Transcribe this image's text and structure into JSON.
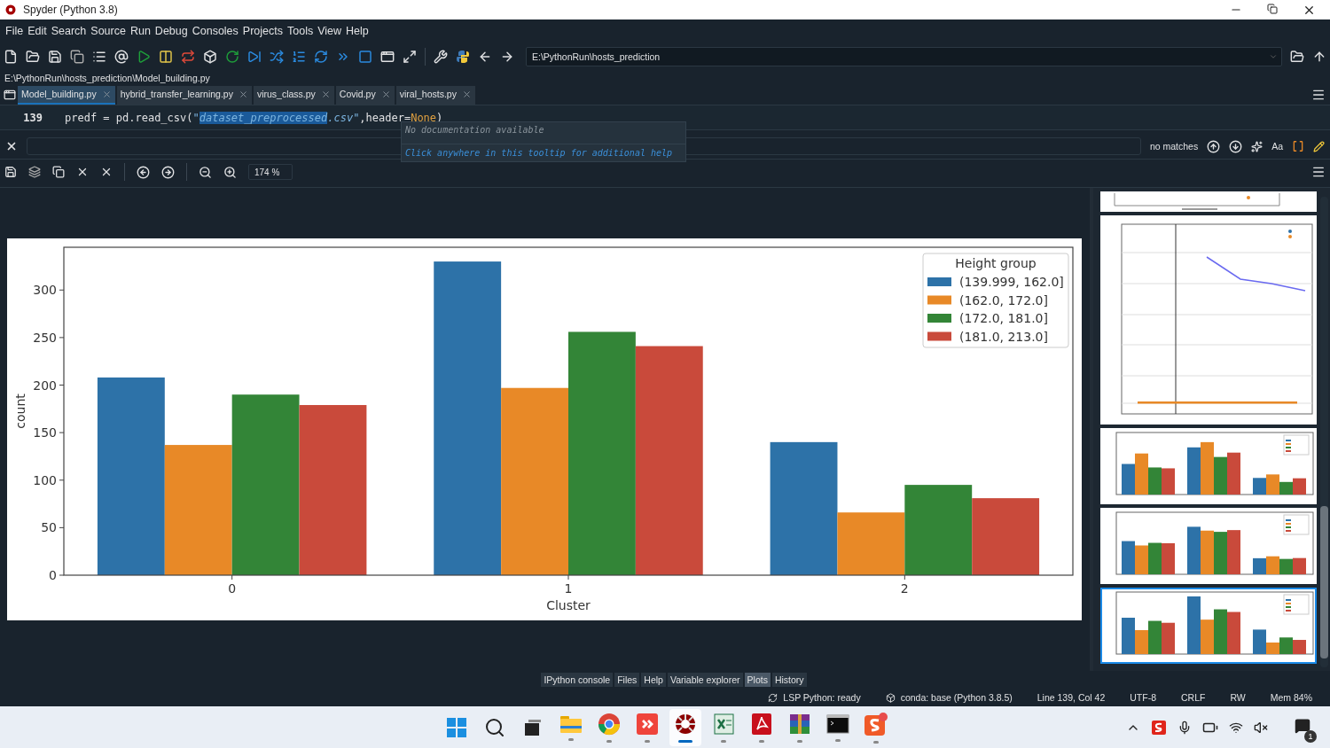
{
  "window": {
    "title": "Spyder (Python 3.8)"
  },
  "menu": [
    "File",
    "Edit",
    "Search",
    "Source",
    "Run",
    "Debug",
    "Consoles",
    "Projects",
    "Tools",
    "View",
    "Help"
  ],
  "toolbar": {
    "path": "E:\\PythonRun\\hosts_prediction"
  },
  "file_path": "E:\\PythonRun\\hosts_prediction\\Model_building.py",
  "editor_tabs": [
    {
      "label": "Model_building.py",
      "selected": true
    },
    {
      "label": "hybrid_transfer_learning.py",
      "selected": false
    },
    {
      "label": "virus_class.py",
      "selected": false
    },
    {
      "label": "Covid.py",
      "selected": false
    },
    {
      "label": "viral_hosts.py",
      "selected": false
    }
  ],
  "editor": {
    "line_number": "139",
    "code": [
      {
        "text": "predf = pd.read_csv(",
        "kind": "plain"
      },
      {
        "text": "\"",
        "kind": "string"
      },
      {
        "text": "dataset_preprocessed",
        "kind": "selected"
      },
      {
        "text": ".csv\"",
        "kind": "string"
      },
      {
        "text": ",header=",
        "kind": "plain"
      },
      {
        "text": "None",
        "kind": "keyword"
      },
      {
        "text": ")",
        "kind": "plain"
      }
    ]
  },
  "tooltip": {
    "message": "No documentation available",
    "hint": "Click anywhere in this tooltip for additional help"
  },
  "find_bar": {
    "status": "no matches",
    "case_label": "Aa"
  },
  "plots": {
    "zoom": "174 %",
    "plot": {
      "legend_title": "Height group",
      "chart_data": {
        "type": "bar",
        "xlabel": "Cluster",
        "ylabel": "count",
        "categories": [
          "0",
          "1",
          "2"
        ],
        "series": [
          {
            "name": "(139.999, 162.0]",
            "color": "#2d72a8",
            "values": [
              208,
              330,
              140
            ]
          },
          {
            "name": "(162.0, 172.0]",
            "color": "#e88927",
            "values": [
              137,
              197,
              66
            ]
          },
          {
            "name": "(172.0, 181.0]",
            "color": "#338537",
            "values": [
              190,
              256,
              95
            ]
          },
          {
            "name": "(181.0, 213.0]",
            "color": "#c94a3b",
            "values": [
              179,
              241,
              81
            ]
          }
        ],
        "ylim": [
          0,
          345
        ],
        "yticks": [
          0,
          50,
          100,
          150,
          200,
          250,
          300
        ],
        "legend": "upper right"
      }
    },
    "thumbnails": [
      {
        "kind": "partial",
        "selected": false
      },
      {
        "kind": "line",
        "selected": false
      },
      {
        "kind": "bar",
        "selected": false
      },
      {
        "kind": "bar",
        "selected": false
      },
      {
        "kind": "bar",
        "selected": true
      }
    ]
  },
  "panes": [
    {
      "label": "IPython console",
      "selected": false
    },
    {
      "label": "Files",
      "selected": false
    },
    {
      "label": "Help",
      "selected": false
    },
    {
      "label": "Variable explorer",
      "selected": false
    },
    {
      "label": "Plots",
      "selected": true
    },
    {
      "label": "History",
      "selected": false
    }
  ],
  "status_bar": {
    "lsp": "LSP Python: ready",
    "conda": "conda: base (Python 3.8.5)",
    "position": "Line 139, Col 42",
    "encoding": "UTF-8",
    "eol": "CRLF",
    "mode": "RW",
    "memory": "Mem 84%"
  },
  "taskbar": {
    "apps": [
      {
        "kind": "start",
        "running": false,
        "active": false
      },
      {
        "kind": "search",
        "running": false,
        "active": false
      },
      {
        "kind": "taskview",
        "running": false,
        "active": false
      },
      {
        "kind": "folder",
        "running": true,
        "active": false
      },
      {
        "kind": "browser",
        "running": true,
        "active": false
      },
      {
        "kind": "remote",
        "running": true,
        "active": false
      },
      {
        "kind": "spyder",
        "running": true,
        "active": true
      },
      {
        "kind": "sheet",
        "running": true,
        "active": false
      },
      {
        "kind": "pdf",
        "running": true,
        "active": false
      },
      {
        "kind": "archive",
        "running": true,
        "active": false
      },
      {
        "kind": "terminal",
        "running": true,
        "active": false
      },
      {
        "kind": "capture",
        "running": true,
        "active": false
      }
    ],
    "notification_count": "1"
  }
}
